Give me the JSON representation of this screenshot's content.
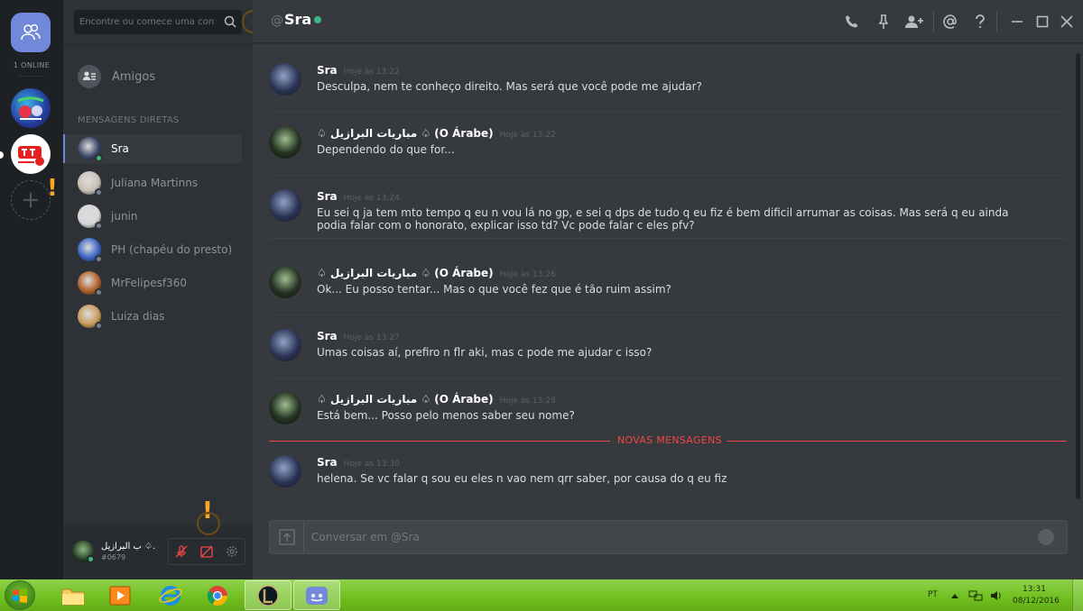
{
  "guilds": {
    "online_count": "1 ONLINE",
    "add_label": "+"
  },
  "search": {
    "placeholder": "Encontre ou comece uma conversa"
  },
  "sidebar": {
    "friends_label": "Amigos",
    "dm_header": "MENSAGENS DIRETAS",
    "dms": [
      {
        "name": "Sra",
        "status_color": "#43b581",
        "avatar_color": "#3a4466",
        "active": true
      },
      {
        "name": "Juliana Martinns",
        "status_color": "#747f8d",
        "avatar_color": "#c9c0b6",
        "active": false
      },
      {
        "name": "junin",
        "status_color": "#747f8d",
        "avatar_color": "#d7d7d7",
        "active": false
      },
      {
        "name": "PH (chapéu do presto)",
        "status_color": "#747f8d",
        "avatar_color": "#3b63c5",
        "active": false
      },
      {
        "name": "MrFelipesf360",
        "status_color": "#747f8d",
        "avatar_color": "#b0602a",
        "active": false
      },
      {
        "name": "Luiza dias",
        "status_color": "#747f8d",
        "avatar_color": "#c89a5a",
        "active": false
      }
    ]
  },
  "user": {
    "name": "ب البرازيل ♤.",
    "tag": "#0679"
  },
  "header": {
    "at": "@",
    "name": "Sra"
  },
  "messages": [
    {
      "author": "Sra",
      "time": "Hoje às 13:22",
      "text": "Desculpa, nem te conheço direito. Mas será que você pode me ajudar?",
      "avatar": "sra"
    },
    {
      "author": "♤ مباريات البرازيل ♤ (O Árabe)",
      "time": "Hoje às 13:22",
      "text": "Dependendo do que for...",
      "avatar": "arb"
    },
    {
      "author": "Sra",
      "time": "Hoje às 13:24",
      "text": "Eu sei q ja tem mto tempo q eu n vou lá no gp, e sei q dps de tudo q eu fiz é bem dificil arrumar as coisas. Mas será q eu ainda podia falar com o honorato, explicar isso td? Vc pode falar c eles pfv?",
      "avatar": "sra"
    },
    {
      "author": "♤ مباريات البرازيل ♤ (O Árabe)",
      "time": "Hoje às 13:26",
      "text": "Ok... Eu posso tentar... Mas o que você fez que é tão ruim assim?",
      "avatar": "arb"
    },
    {
      "author": "Sra",
      "time": "Hoje às 13:27",
      "text": "Umas coisas aí, prefiro n flr aki, mas c pode me ajudar c isso?",
      "avatar": "sra"
    },
    {
      "author": "♤ مباريات البرازيل ♤ (O Árabe)",
      "time": "Hoje às 13:28",
      "text": "Está bem... Posso pelo menos saber seu nome?",
      "avatar": "arb"
    },
    {
      "author": "Sra",
      "time": "Hoje às 13:30",
      "text": "helena. Se vc falar q sou eu eles n vao nem qrr saber, por causa do q eu fiz",
      "avatar": "sra"
    }
  ],
  "new_messages_label": "NOVAS MENSAGENS",
  "composer": {
    "placeholder": "Conversar em @Sra"
  },
  "taskbar": {
    "lang": "PT",
    "time": "13:31",
    "date": "08/12/2016"
  },
  "colors": {
    "accent": "#7289da",
    "online": "#43b581",
    "alert": "#f04747",
    "warning": "#f9a825"
  }
}
